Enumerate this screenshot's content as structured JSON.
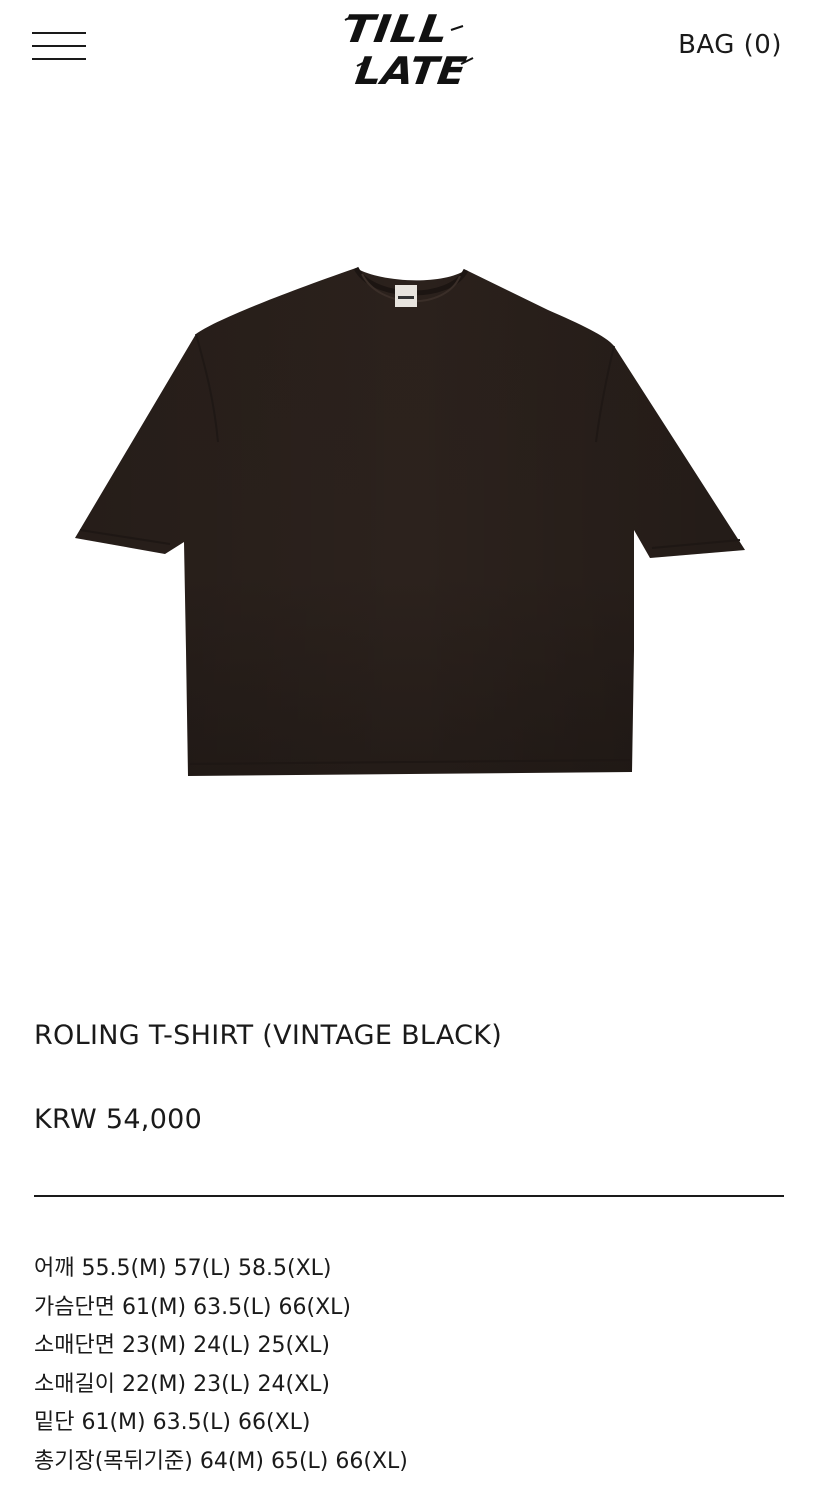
{
  "header": {
    "logo_text": "TILL LATE",
    "bag_label": "BAG (0)",
    "menu_icon": "hamburger-menu-icon"
  },
  "product": {
    "title": "ROLING T-SHIRT (VINTAGE BLACK)",
    "price": "KRW 54,000",
    "image_alt": "product-photo-tshirt",
    "color": "#2a211d"
  },
  "size_info": [
    "어깨 55.5(M) 57(L) 58.5(XL)",
    "가슴단면 61(M) 63.5(L) 66(XL)",
    "소매단면 23(M) 24(L) 25(XL)",
    "소매길이 22(M) 23(L) 24(XL)",
    "밑단 61(M) 63.5(L) 66(XL)",
    "총기장(목뒤기준) 64(M) 65(L) 66(XL)"
  ]
}
